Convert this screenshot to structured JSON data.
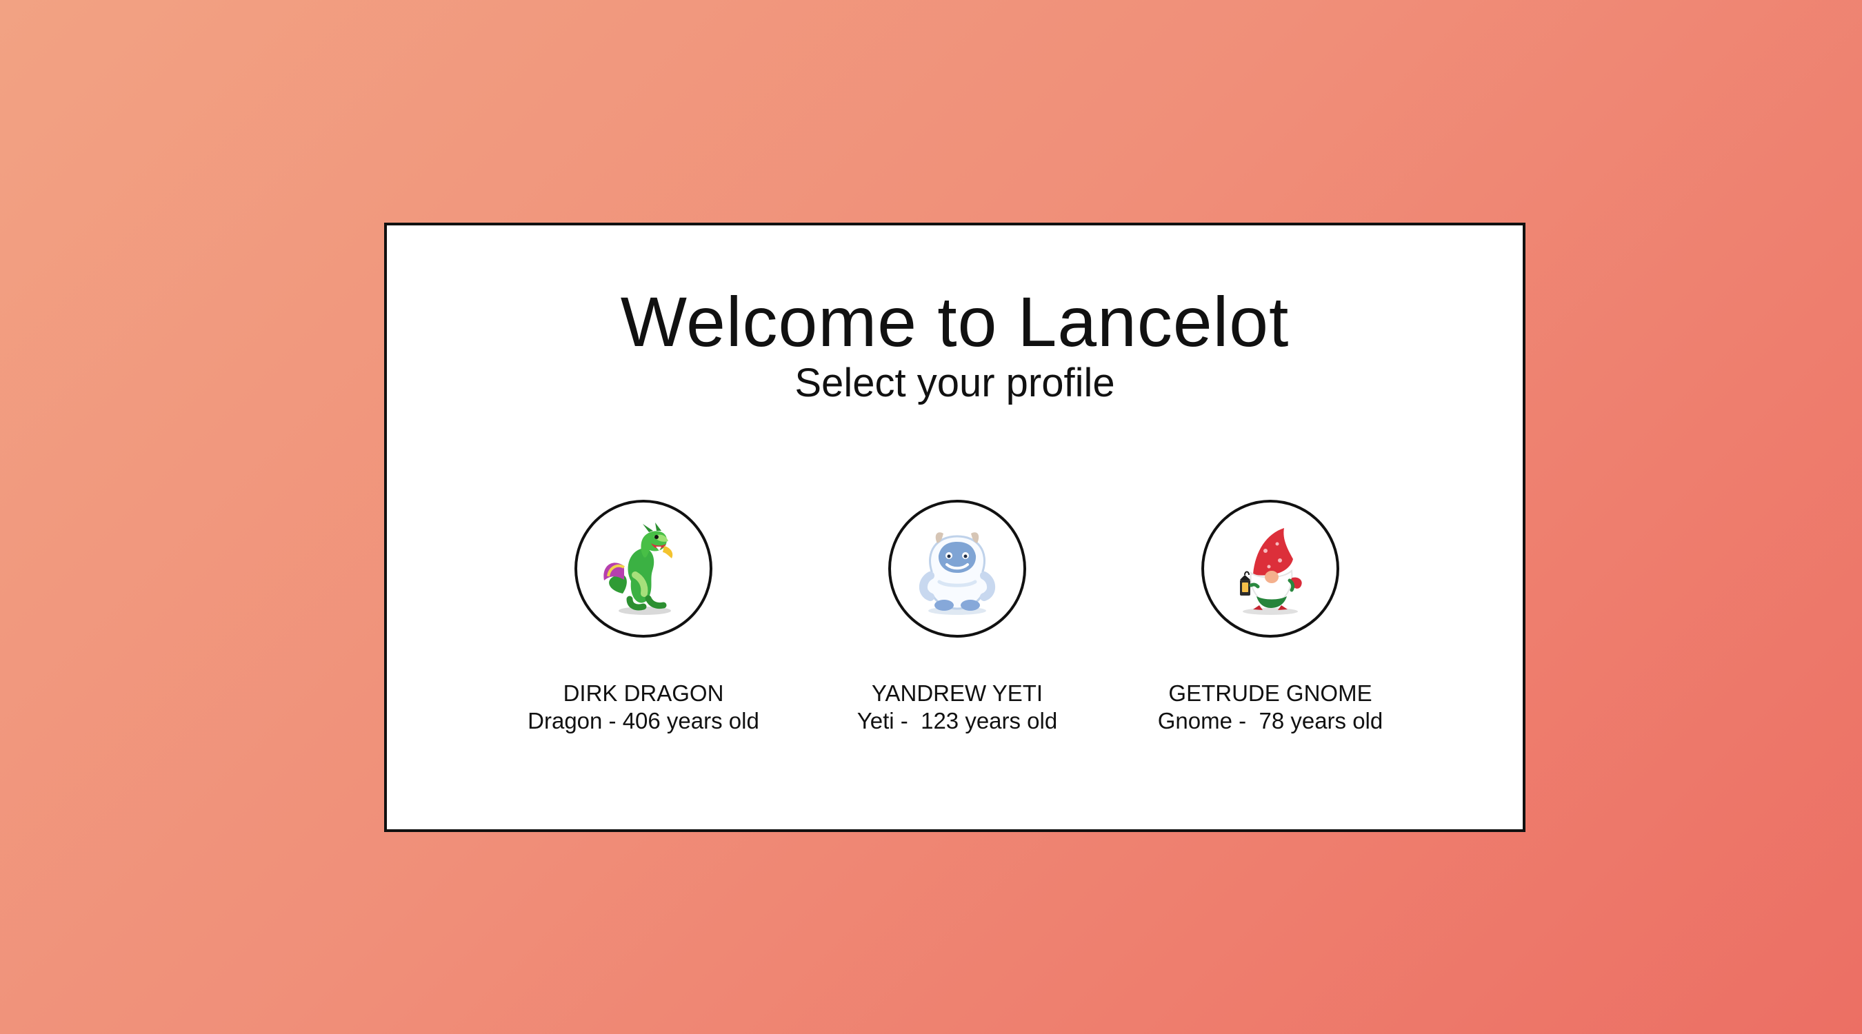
{
  "header": {
    "title": "Welcome to Lancelot",
    "subtitle": "Select your profile"
  },
  "profiles": [
    {
      "name": "DIRK DRAGON",
      "description": "Dragon - 406 years old",
      "icon": "dragon-icon"
    },
    {
      "name": "YANDREW YETI",
      "description": "Yeti -  123 years old",
      "icon": "yeti-icon"
    },
    {
      "name": "GETRUDE GNOME",
      "description": "Gnome -  78 years old",
      "icon": "gnome-icon"
    }
  ],
  "colors": {
    "background_start": "#f2a283",
    "background_end": "#ec6f64",
    "card": "#ffffff",
    "border": "#111111"
  }
}
